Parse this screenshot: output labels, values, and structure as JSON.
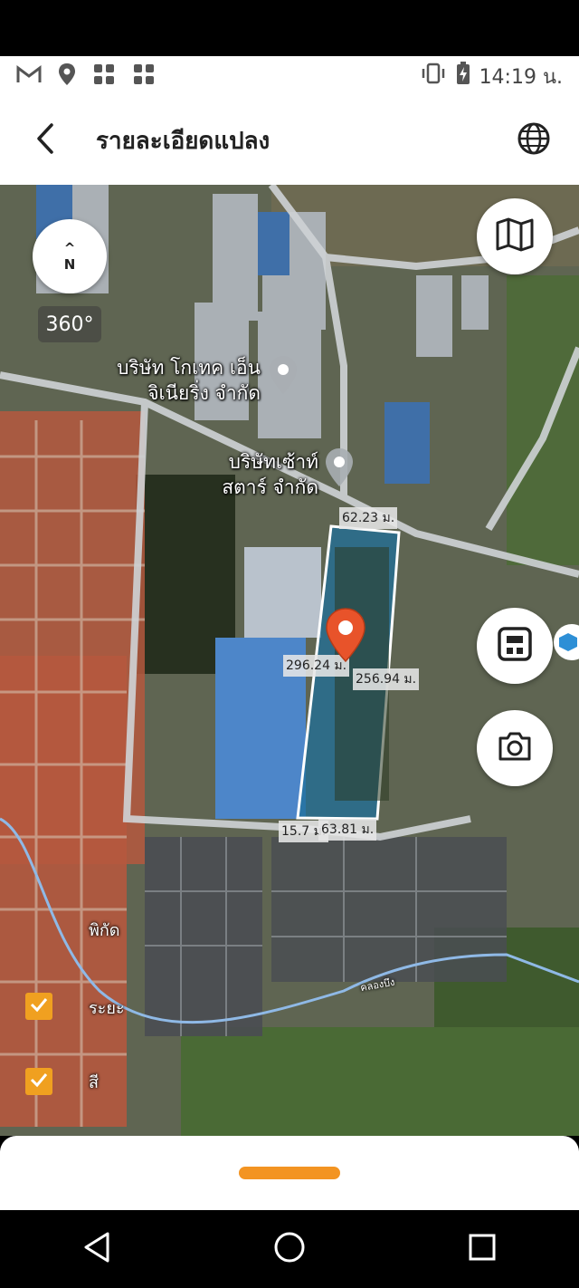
{
  "status_bar": {
    "time": "14:19 น.",
    "icons": [
      "gmail-icon",
      "location-icon",
      "grid-app-icon",
      "grid-app-icon",
      "vibrate-icon",
      "battery-charging-icon"
    ]
  },
  "header": {
    "title": "รายละเอียดแปลง",
    "back_icon": "chevron-left-icon",
    "globe_icon": "globe-icon"
  },
  "map": {
    "compass": {
      "arrow": "^",
      "letter": "N"
    },
    "view_360_label": "360°",
    "pois": [
      {
        "line1": "บริษัท โกเทค เอ็น",
        "line2": "จิเนียริ่ง จำกัด"
      },
      {
        "line1": "บริษัทเซ้าท์",
        "line2": "สตาร์ จำกัด"
      }
    ],
    "dimensions": {
      "top": "62.23 ม.",
      "left": "296.24 ม.",
      "right": "256.94 ม.",
      "bottom_a": "15.7 ม.",
      "bottom_b": "63.81 ม."
    },
    "labels": {
      "coordinates_label": "พิกัด",
      "distance_label": "ระยะ",
      "color_label": "สี",
      "canal_label": "คลองบึง"
    },
    "fab_icons": [
      "map-icon",
      "layers-icon",
      "camera-icon"
    ],
    "colors": {
      "plot_fill": "#1f6f9a",
      "plot_border": "#ffffff",
      "pin": "#e8532a",
      "accent": "#f39422"
    }
  },
  "nav": {
    "icons": [
      "back-triangle-icon",
      "home-circle-icon",
      "recents-square-icon"
    ]
  }
}
